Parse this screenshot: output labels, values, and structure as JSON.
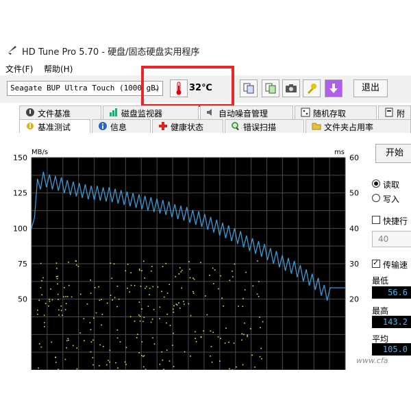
{
  "window": {
    "title": "HD Tune Pro 5.70 - 硬盘/固态硬盘实用程序"
  },
  "menu": {
    "file": "文件(F)",
    "help": "帮助(H)"
  },
  "toolbar": {
    "drive": "Seagate BUP Ultra Touch (1000 gB)",
    "temperature": "32℃",
    "exit_label": "退出",
    "icons": [
      "thermometer-icon",
      "copy-icon",
      "copy-info-icon",
      "camera-icon",
      "wrench-icon",
      "download-arrow-icon"
    ]
  },
  "tabs_row1": [
    "文件基准",
    "磁盘监视器",
    "自动噪音管理",
    "随机存取",
    "附"
  ],
  "tabs_row2": [
    "基准测试",
    "信息",
    "健康状态",
    "错误扫描",
    "文件夹占用率"
  ],
  "side": {
    "start_label": "开始",
    "read_label": "读取",
    "write_label": "写入",
    "quick_label": "快捷行",
    "quick_value": "40",
    "transfer_label": "传输速",
    "min_label": "最低",
    "min_value": "56.6",
    "max_label": "最高",
    "max_value": "143.2",
    "avg_label": "平均",
    "avg_value": "105.0"
  },
  "watermark": "www.cfa",
  "chart_data": {
    "type": "line",
    "left_axis": {
      "label": "MB/s",
      "ticks": [
        150,
        125,
        100,
        75,
        50
      ],
      "range": [
        0,
        150
      ]
    },
    "right_axis": {
      "label": "ms",
      "ticks": [
        60,
        50,
        40,
        30,
        20
      ],
      "range": [
        0,
        60
      ]
    },
    "grid": true,
    "series": [
      {
        "name": "",
        "color": "#3c9bd6",
        "x": [
          0,
          2,
          4,
          6,
          8,
          10,
          12,
          14,
          16,
          18,
          20,
          22,
          24,
          26,
          28,
          30,
          32,
          34,
          36,
          38,
          40,
          42,
          44,
          46,
          48,
          50,
          52,
          54,
          56,
          58,
          60,
          62,
          64,
          66,
          68,
          70,
          72,
          74,
          76,
          78,
          80,
          82,
          84,
          86,
          88,
          90,
          92,
          94,
          96,
          98,
          100
        ],
        "y": [
          100,
          135,
          140,
          138,
          137,
          136,
          134,
          133,
          132,
          131,
          130,
          130,
          129,
          129,
          128,
          127,
          126,
          125,
          124,
          123,
          122,
          121,
          120,
          119,
          117,
          116,
          115,
          113,
          112,
          110,
          108,
          106,
          104,
          102,
          100,
          98,
          95,
          93,
          91,
          89,
          86,
          84,
          81,
          79,
          77,
          74,
          71,
          68,
          65,
          60,
          58
        ]
      }
    ],
    "scatter_color": "#e0e05a"
  }
}
